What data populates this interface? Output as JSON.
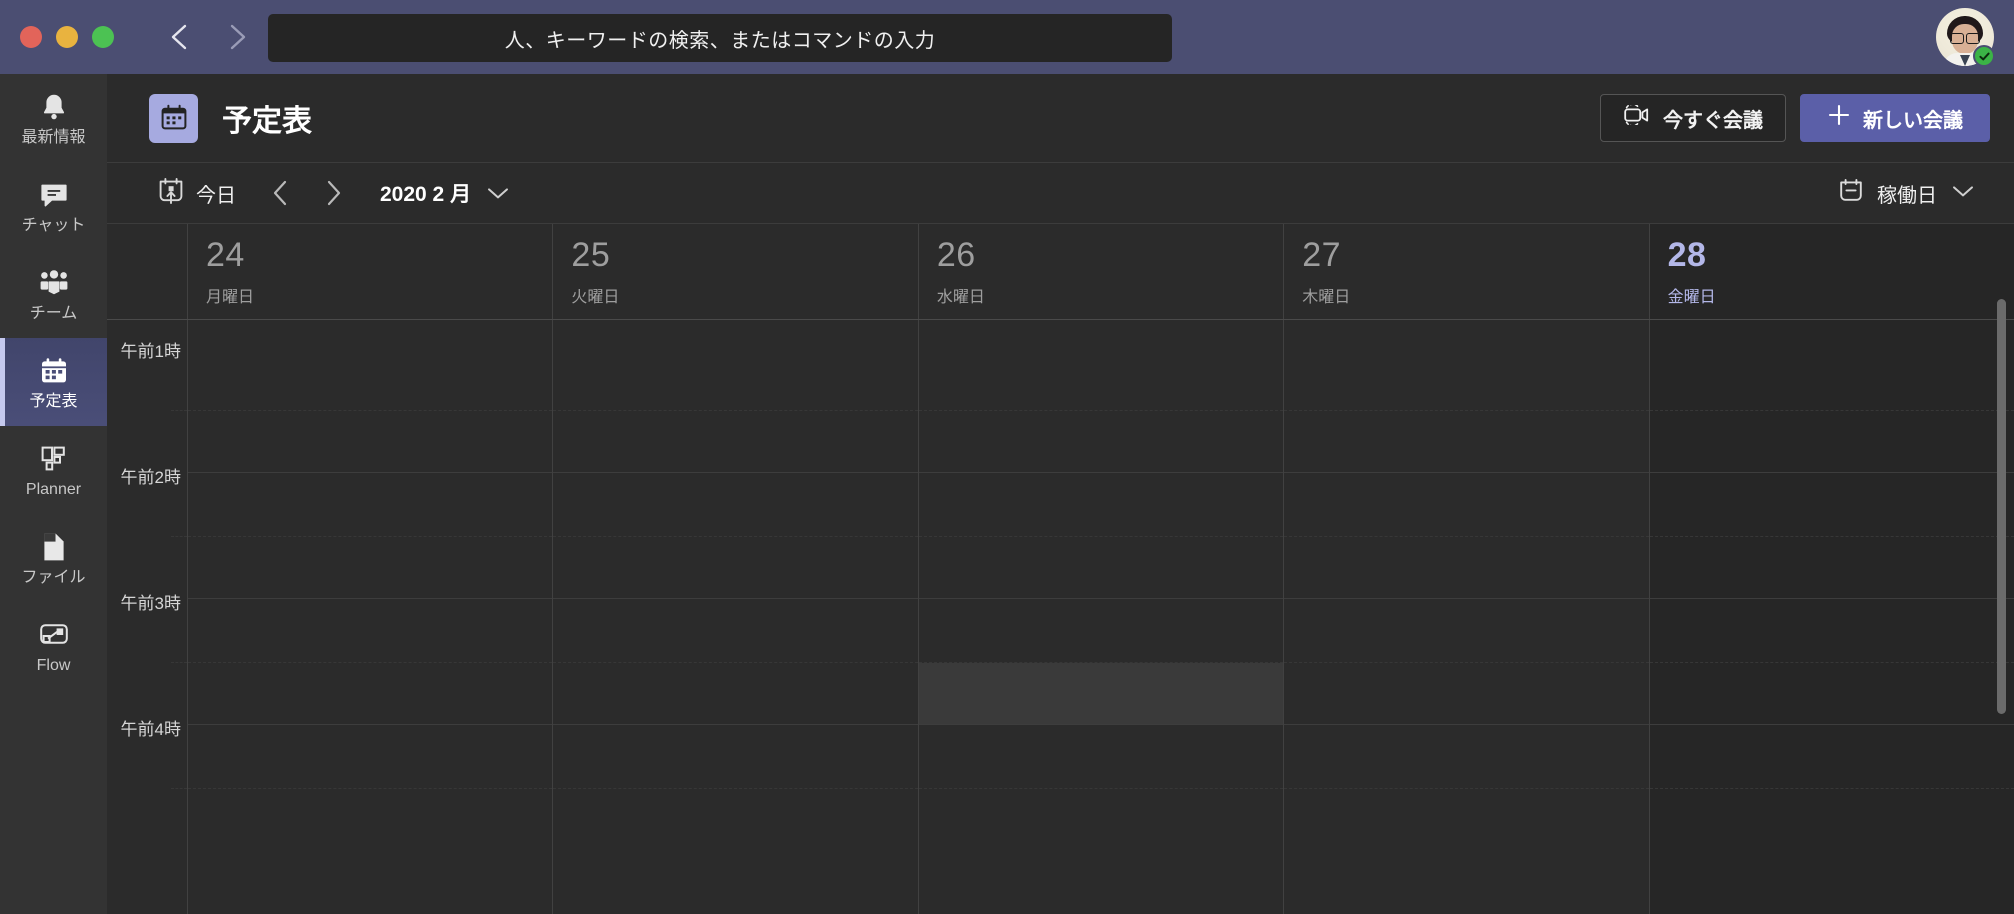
{
  "window": {
    "traffic_lights": [
      "close",
      "minimize",
      "zoom"
    ],
    "nav_back_icon": "chevron-left-icon",
    "nav_forward_icon": "chevron-right-icon",
    "compose_icon": "compose-icon"
  },
  "search": {
    "placeholder": "人、キーワードの検索、またはコマンドの入力",
    "value": ""
  },
  "user": {
    "avatar_alt": "user-avatar",
    "presence": "available",
    "presence_color": "#3bb346"
  },
  "sidebar": {
    "items": [
      {
        "label": "最新情報",
        "icon": "bell-icon",
        "active": false
      },
      {
        "label": "チャット",
        "icon": "chat-icon",
        "active": false
      },
      {
        "label": "チーム",
        "icon": "people-icon",
        "active": false
      },
      {
        "label": "予定表",
        "icon": "calendar-icon",
        "active": true
      },
      {
        "label": "Planner",
        "icon": "planner-icon",
        "active": false
      },
      {
        "label": "ファイル",
        "icon": "file-icon",
        "active": false
      },
      {
        "label": "Flow",
        "icon": "flow-icon",
        "active": false
      }
    ]
  },
  "header": {
    "app_icon": "calendar-icon",
    "title": "予定表",
    "meet_now_label": "今すぐ会議",
    "meet_now_icon": "video-camera-icon",
    "new_meeting_label": "新しい会議",
    "new_meeting_icon": "plus-icon",
    "primary_color": "#5b5fa8",
    "app_icon_color": "#a6aae0"
  },
  "toolbar": {
    "today_label": "今日",
    "today_icon": "calendar-today-icon",
    "prev_icon": "chevron-left-icon",
    "next_icon": "chevron-right-icon",
    "month_label": "2020 2 月",
    "month_chevron_icon": "chevron-down-icon",
    "view_label": "稼働日",
    "view_icon": "calendar-workweek-icon",
    "view_chevron_icon": "chevron-down-icon"
  },
  "calendar": {
    "days": [
      {
        "num": "24",
        "weekday": "月曜日",
        "today": false
      },
      {
        "num": "25",
        "weekday": "火曜日",
        "today": false
      },
      {
        "num": "26",
        "weekday": "水曜日",
        "today": false
      },
      {
        "num": "27",
        "weekday": "木曜日",
        "today": false
      },
      {
        "num": "28",
        "weekday": "金曜日",
        "today": true
      }
    ],
    "hours": [
      "午前1時",
      "午前2時",
      "午前3時",
      "午前4時"
    ],
    "hover_slot": {
      "day_index": 2,
      "start": "午前3時30分",
      "end": "午前4時"
    },
    "today_accent": "#b3b7e8",
    "events": []
  }
}
